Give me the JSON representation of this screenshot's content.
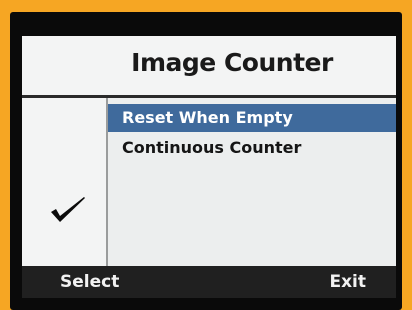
{
  "screen": {
    "title": "Image Counter"
  },
  "menu": {
    "items": [
      {
        "label": "Reset When Empty",
        "selected": true,
        "checked": false
      },
      {
        "label": "Continuous Counter",
        "selected": false,
        "checked": true
      }
    ]
  },
  "icons": {
    "checkmark": "checkmark-icon"
  },
  "softkeys": {
    "left_label": "Select",
    "right_label": "Exit"
  },
  "colors": {
    "highlight": "#3f6a9c",
    "background": "#f6a623"
  }
}
